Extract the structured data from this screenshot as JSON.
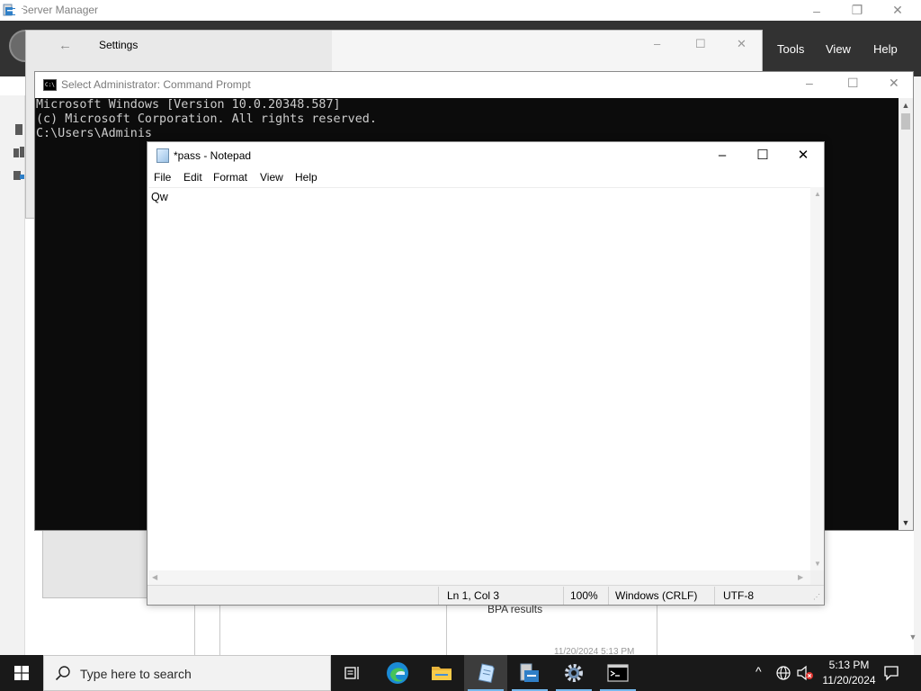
{
  "server_manager": {
    "title": "Server Manager",
    "menu": {
      "tools": "Tools",
      "view": "View",
      "help": "Help"
    },
    "controls": {
      "minimize": "–",
      "restore": "❐",
      "close": "✕"
    },
    "bpa_label": "BPA results",
    "bpa_timestamp": "11/20/2024 5:13 PM"
  },
  "settings": {
    "title": "Settings",
    "back_glyph": "←",
    "controls": {
      "minimize": "–",
      "maximize": "☐",
      "close": "✕"
    }
  },
  "cmd": {
    "title": "Select Administrator: Command Prompt",
    "icon_text": "C:\\",
    "lines": [
      "Microsoft Windows [Version 10.0.20348.587]",
      "(c) Microsoft Corporation. All rights reserved.",
      "",
      "C:\\Users\\Adminis"
    ],
    "controls": {
      "minimize": "–",
      "maximize": "☐",
      "close": "✕"
    },
    "scroll_up": "▲",
    "scroll_down": "▼"
  },
  "notepad": {
    "title": "*pass - Notepad",
    "menu": [
      "File",
      "Edit",
      "Format",
      "View",
      "Help"
    ],
    "content": "Qw",
    "controls": {
      "minimize": "–",
      "maximize": "☐",
      "close": "✕"
    },
    "status": {
      "position": "Ln 1, Col 3",
      "zoom": "100%",
      "line_ending": "Windows (CRLF)",
      "encoding": "UTF-8"
    }
  },
  "taskbar": {
    "search_placeholder": "Type here to search",
    "apps": [
      {
        "name": "Task View",
        "icon": "task-view-icon"
      },
      {
        "name": "Microsoft Edge",
        "icon": "edge-icon"
      },
      {
        "name": "File Explorer",
        "icon": "folder-icon"
      },
      {
        "name": "Notepad",
        "icon": "notepad-icon",
        "active": true
      },
      {
        "name": "Server Manager",
        "icon": "server-manager-icon"
      },
      {
        "name": "Settings",
        "icon": "gear-icon"
      },
      {
        "name": "Command Prompt",
        "icon": "cmd-icon"
      }
    ],
    "tray": {
      "chevron": "^",
      "time": "5:13 PM",
      "date": "11/20/2024"
    }
  },
  "colors": {
    "accent": "#1d72c8",
    "taskbar_bg": "#191919",
    "console_bg": "#0c0c0c",
    "console_fg": "#cccccc",
    "header_bg": "#323232"
  }
}
